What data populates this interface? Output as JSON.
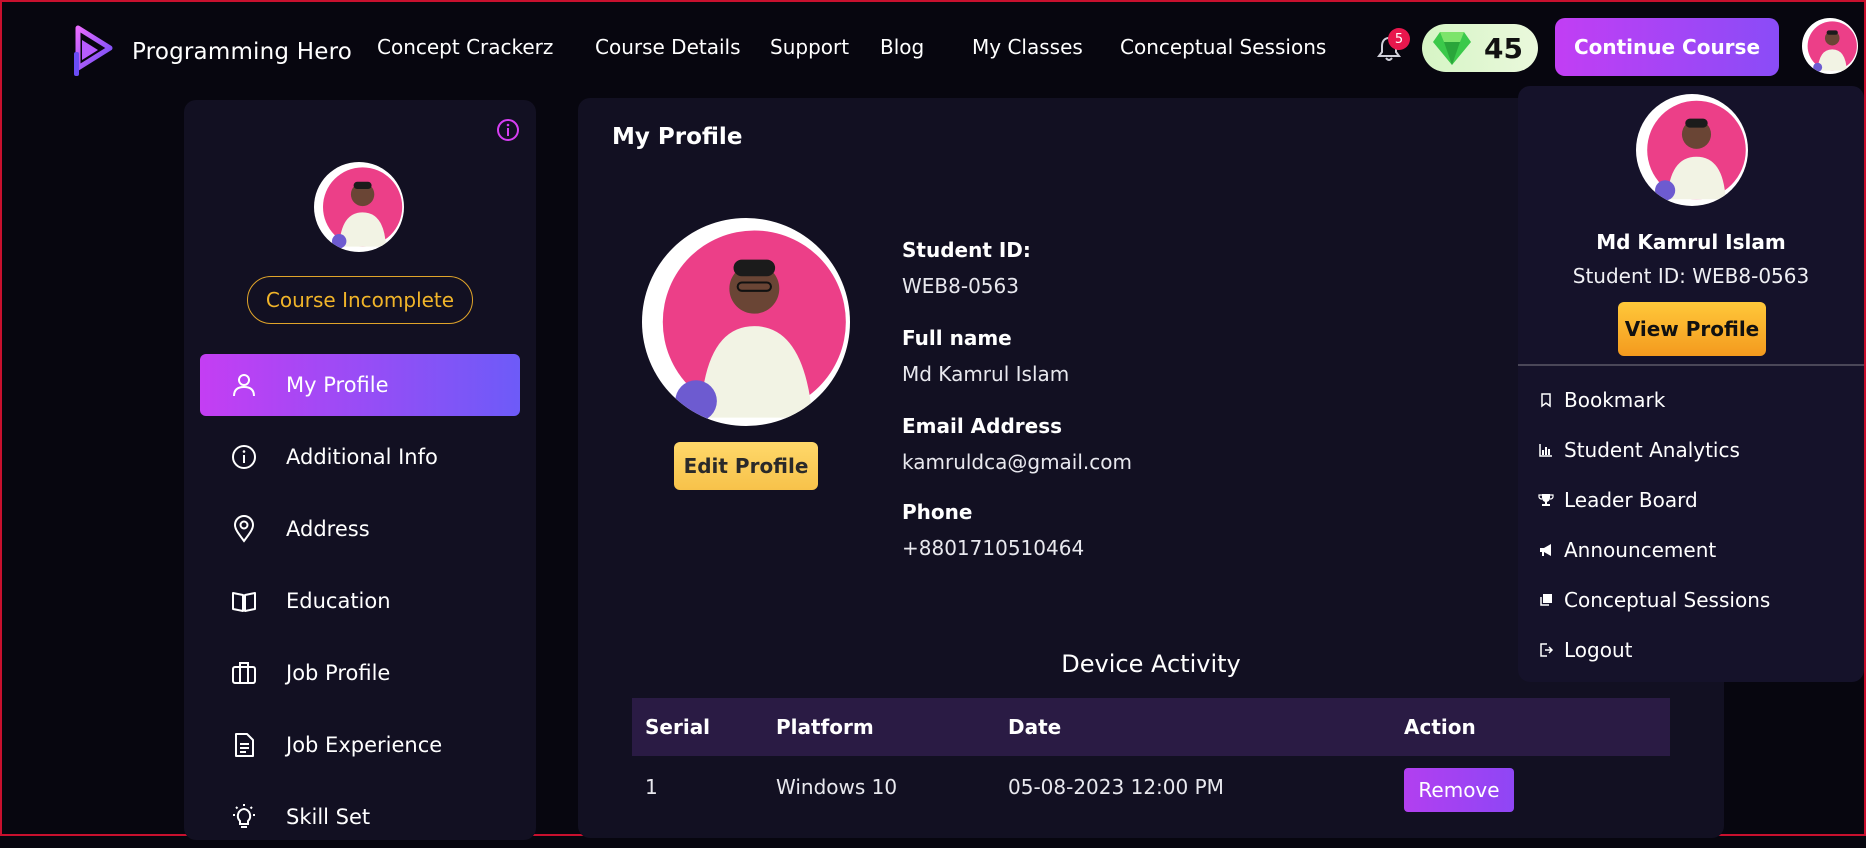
{
  "header": {
    "brand": "Programming Hero",
    "nav": [
      "Concept Crackerz",
      "Course Details",
      "Support",
      "Blog",
      "My Classes",
      "Conceptual Sessions"
    ],
    "notification_count": "5",
    "gems": "45",
    "continue_label": "Continue Course"
  },
  "sidebar": {
    "status_badge": "Course Incomplete",
    "items": [
      {
        "label": "My Profile",
        "icon": "user-icon"
      },
      {
        "label": "Additional Info",
        "icon": "info-icon"
      },
      {
        "label": "Address",
        "icon": "location-pin-icon"
      },
      {
        "label": "Education",
        "icon": "book-icon"
      },
      {
        "label": "Job Profile",
        "icon": "briefcase-icon"
      },
      {
        "label": "Job Experience",
        "icon": "document-icon"
      },
      {
        "label": "Skill Set",
        "icon": "lightbulb-icon"
      }
    ]
  },
  "profile": {
    "title": "My Profile",
    "edit_label": "Edit Profile",
    "fields": [
      {
        "label": "Student ID:",
        "value": "WEB8-0563"
      },
      {
        "label": "Full name",
        "value": "Md Kamrul Islam"
      },
      {
        "label": "Email Address",
        "value": "kamruldca@gmail.com"
      },
      {
        "label": "Phone",
        "value": "+8801710510464"
      }
    ]
  },
  "device_activity": {
    "title": "Device Activity",
    "columns": [
      "Serial",
      "Platform",
      "Date",
      "Action"
    ],
    "rows": [
      {
        "serial": "1",
        "platform": "Windows 10",
        "date": "05-08-2023 12:00 PM",
        "action": "Remove"
      }
    ]
  },
  "dropdown": {
    "name": "Md Kamrul Islam",
    "student_id": "Student ID: WEB8-0563",
    "view_label": "View Profile",
    "items": [
      {
        "label": "Bookmark",
        "icon": "bookmark-icon"
      },
      {
        "label": "Student Analytics",
        "icon": "bar-chart-icon"
      },
      {
        "label": "Leader Board",
        "icon": "trophy-icon"
      },
      {
        "label": "Announcement",
        "icon": "megaphone-icon"
      },
      {
        "label": "Conceptual Sessions",
        "icon": "sessions-icon"
      },
      {
        "label": "Logout",
        "icon": "logout-icon"
      }
    ]
  },
  "colors": {
    "accent_purple": "#c23ef4",
    "accent_gold": "#f0b429",
    "panel": "#121022",
    "background": "#07060f"
  }
}
